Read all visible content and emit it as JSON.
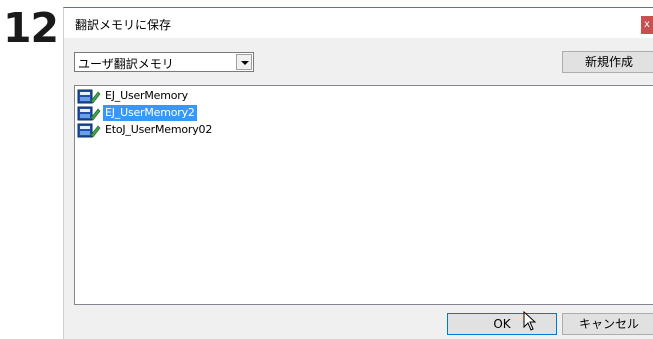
{
  "step_number": "12",
  "dialog": {
    "title": "翻訳メモリに保存",
    "close_label": "x"
  },
  "memory_type": {
    "selected": "ユーザ翻訳メモリ"
  },
  "buttons": {
    "new": "新規作成",
    "ok": "OK",
    "cancel": "キャンセル"
  },
  "memory_list": {
    "items": [
      {
        "label": "EJ_UserMemory",
        "selected": false,
        "icon": "translation-memory-icon"
      },
      {
        "label": "EJ_UserMemory2",
        "selected": true,
        "icon": "translation-memory-icon"
      },
      {
        "label": "EtoJ_UserMemory02",
        "selected": false,
        "icon": "translation-memory-icon"
      }
    ]
  },
  "colors": {
    "selection": "#3399ff",
    "close": "#c75050",
    "title_border": "#3c7fb1"
  }
}
